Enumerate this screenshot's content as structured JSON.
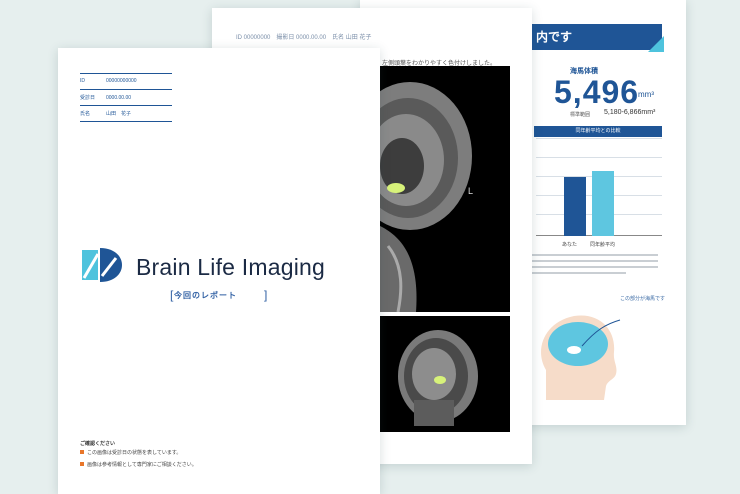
{
  "right_page": {
    "banner": "内です",
    "small_heading": "海馬体積",
    "big_number": "5,496",
    "unit": "mm³",
    "range_label": "標準範囲",
    "range_value": "5,180-6,866mm³",
    "blue_button": "同年齢平均との比較",
    "chart_data": {
      "type": "bar",
      "categories": [
        "あなた",
        "同年齢平均"
      ],
      "values": [
        5496,
        6050
      ],
      "colors": [
        "#1f5596",
        "#5ec6e0"
      ],
      "ylim": [
        0,
        8000
      ],
      "grid": true
    },
    "note": "この部分が海馬です"
  },
  "middle_page": {
    "header": "ID 00000000　撮影日 0000.00.00　氏名 山田 花子",
    "caption": "左側頭葉をわかりやすく色付けしました。",
    "mri_marker": "L"
  },
  "front_page": {
    "fields": [
      {
        "label": "ID",
        "value": "00000000000"
      },
      {
        "label": "受診日",
        "value": "0000.00.00"
      },
      {
        "label": "氏名",
        "value": "山田　花子"
      }
    ],
    "logo_text": "Brain Life Imaging",
    "report_label": "今回のレポート",
    "footer_title": "ご確認ください",
    "footer_items": [
      "この画像は受診日の状態を表しています。",
      "画像は参考情報として専門家にご相談ください。"
    ]
  },
  "colors": {
    "brand_blue": "#1f5596",
    "accent_cyan": "#5ec6e0",
    "background": "#e6efee"
  }
}
